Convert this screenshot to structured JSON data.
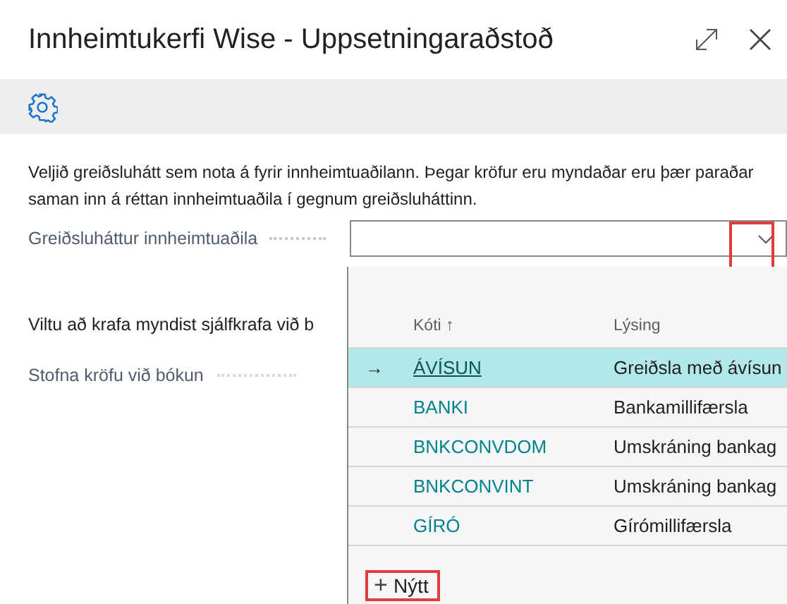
{
  "window": {
    "title": "Innheimtukerfi Wise - Uppsetningaraðstoð"
  },
  "intro": "Veljið greiðsluhátt sem nota á fyrir innheimtuaðilann. Þegar kröfur eru myndaðar eru þær paraðar saman inn á réttan innheimtuaðila í gegnum greiðsluháttinn.",
  "payment_field": {
    "label": "Greiðsluháttur innheimtuaðila"
  },
  "question": "Viltu að krafa myndist sjálfkrafa við b",
  "create_field": {
    "label": "Stofna kröfu við bókun"
  },
  "dropdown": {
    "columns": [
      "Kóti ↑",
      "Lýsing"
    ],
    "rows": [
      {
        "code": "ÁVÍSUN",
        "description": "Greiðsla með ávísun",
        "selected": true,
        "marker": "→"
      },
      {
        "code": "BANKI",
        "description": "Bankamillifærsla",
        "selected": false
      },
      {
        "code": "BNKCONVDOM",
        "description": "Umskráning bankag",
        "selected": false
      },
      {
        "code": "BNKCONVINT",
        "description": "Umskráning bankag",
        "selected": false
      },
      {
        "code": "GÍRÓ",
        "description": "Gírómillifærsla",
        "selected": false
      }
    ],
    "new_button": {
      "icon": "+",
      "label": "Nýtt"
    }
  }
}
